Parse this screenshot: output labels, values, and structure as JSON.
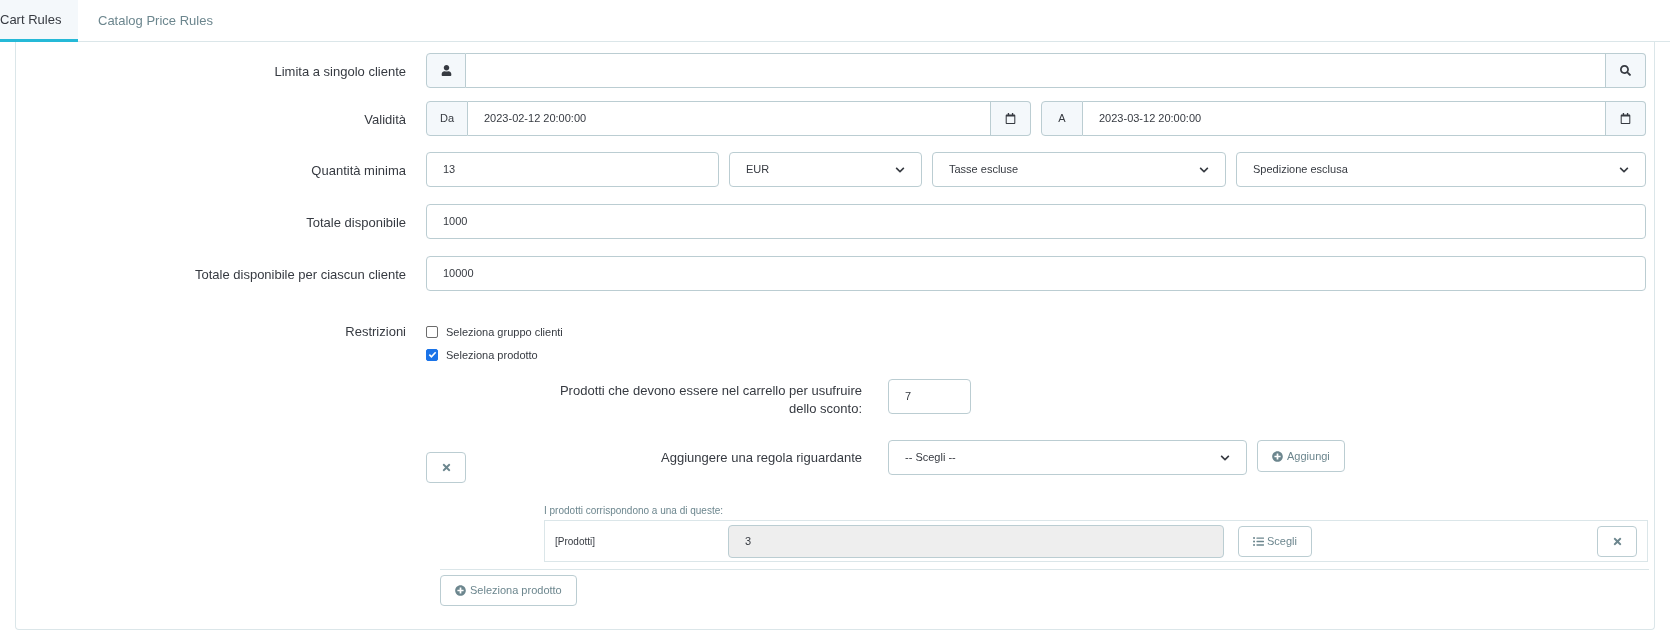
{
  "tabs": [
    {
      "label": "Cart Rules",
      "selected": true
    },
    {
      "label": "Catalog Price Rules",
      "selected": false
    }
  ],
  "customer": {
    "label": "Limita a singolo cliente"
  },
  "validity": {
    "label": "Validità",
    "from_label": "Da",
    "from_value": "2023-02-12 20:00:00",
    "to_label": "A",
    "to_value": "2023-03-12 20:00:00"
  },
  "minimum": {
    "label": "Quantità minima",
    "value": "13",
    "currency": "EUR",
    "tax": "Tasse escluse",
    "shipping": "Spedizione esclusa"
  },
  "total_available": {
    "label": "Totale disponibile",
    "value": "1000"
  },
  "total_per_customer": {
    "label": "Totale disponibile per ciascun cliente",
    "value": "10000"
  },
  "restrictions": {
    "label": "Restrizioni",
    "options": [
      {
        "label": "Seleziona gruppo clienti",
        "checked": false
      },
      {
        "label": "Seleziona prodotto",
        "checked": true
      }
    ]
  },
  "product_rule": {
    "quantity_label": "Prodotti che devono essere nel carrello per usufruire dello sconto:",
    "quantity_value": "7",
    "add_label": "Aggiungere una regola riguardante",
    "add_select": "-- Scegli --",
    "add_button": "Aggiungi",
    "match_label": "I prodotti corrispondono a una di queste:",
    "rules": [
      {
        "type": "[Prodotti]",
        "value": "3",
        "choose_button": "Scegli"
      }
    ]
  },
  "select_product_button": "Seleziona prodotto"
}
